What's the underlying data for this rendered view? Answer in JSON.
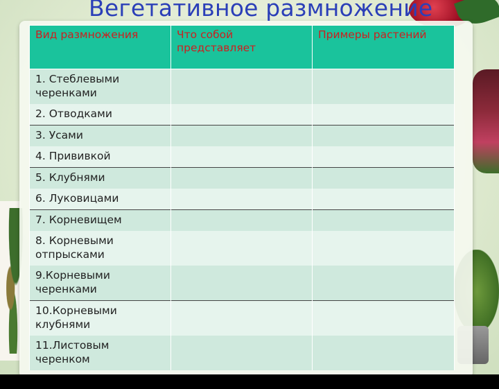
{
  "title": "Вегетативное размножение",
  "table": {
    "headers": [
      "Вид размножения",
      "Что собой представляет",
      "Примеры растений"
    ],
    "rows": [
      {
        "type": "1. Стеблевыми черенками",
        "what": "",
        "examples": ""
      },
      {
        "type": "2. Отводками",
        "what": "",
        "examples": ""
      },
      {
        "type": "3. Усами",
        "what": "",
        "examples": ""
      },
      {
        "type": "4. Прививкой",
        "what": "",
        "examples": ""
      },
      {
        "type": "5. Клубнями",
        "what": "",
        "examples": ""
      },
      {
        "type": "6. Луковицами",
        "what": "",
        "examples": ""
      },
      {
        "type": "7. Корневищем",
        "what": "",
        "examples": ""
      },
      {
        "type": "8. Корневыми отпрысками",
        "what": "",
        "examples": ""
      },
      {
        "type": "9.Корневыми черенками",
        "what": "",
        "examples": ""
      },
      {
        "type": "10.Корневыми клубнями",
        "what": "",
        "examples": ""
      },
      {
        "type": "11.Листовым черенком",
        "what": "",
        "examples": ""
      }
    ]
  },
  "colors": {
    "title": "#2b3fb8",
    "header_bg": "#1ac39c",
    "header_text": "#cc1f1f",
    "row_odd": "#cfe9dd",
    "row_even": "#e6f4ed"
  }
}
